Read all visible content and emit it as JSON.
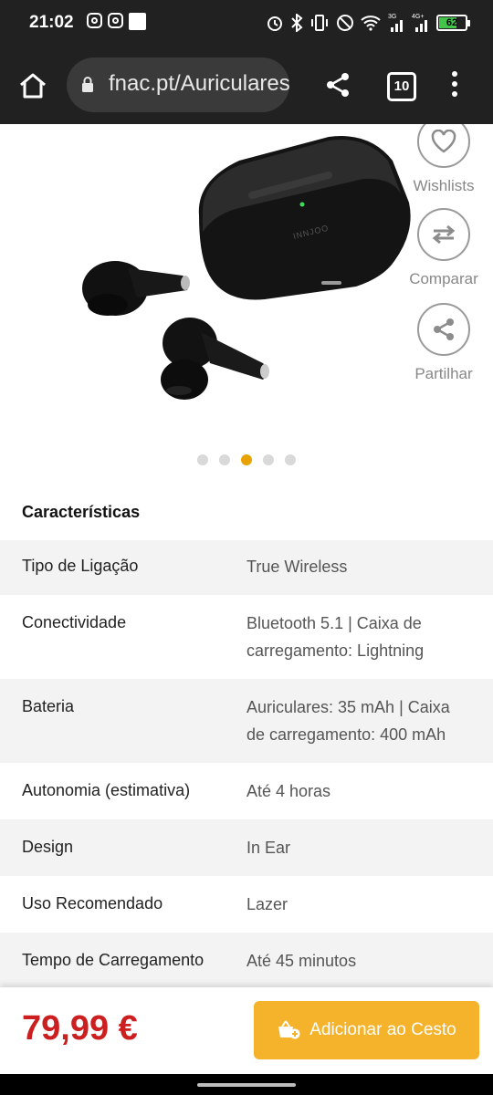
{
  "status_bar": {
    "time": "21:02",
    "notification_icons": [
      "instagram-icon",
      "instagram-icon",
      "app-square-icon"
    ],
    "system_icons": [
      "alarm-icon",
      "bluetooth-icon",
      "vibrate-icon",
      "dnd-icon",
      "wifi-icon",
      "signal-3g-icon",
      "signal-4g-icon",
      "battery-icon"
    ],
    "network_a": "3G",
    "network_b": "4G+",
    "battery_level": "62"
  },
  "browser": {
    "url": "fnac.pt/Auriculares",
    "tab_count": "10",
    "icons": [
      "home-icon",
      "lock-icon",
      "share-icon",
      "tabs-icon",
      "more-vert-icon"
    ]
  },
  "product": {
    "image_alt": "earbuds-with-charging-case",
    "case_brand": "INNJOO",
    "actions": [
      {
        "label": "Wishlists",
        "icon": "heart-icon"
      },
      {
        "label": "Comparar",
        "icon": "swap-icon"
      },
      {
        "label": "Partilhar",
        "icon": "share-icon"
      }
    ],
    "carousel": {
      "total": 5,
      "active_index": 2
    }
  },
  "specs": {
    "title": "Características",
    "rows": [
      {
        "key": "Tipo de Ligação",
        "value": "True Wireless"
      },
      {
        "key": "Conectividade",
        "value": "Bluetooth 5.1 | Caixa de carregamento: Lightning"
      },
      {
        "key": "Bateria",
        "value": "Auriculares: 35 mAh | Caixa de carregamento: 400 mAh"
      },
      {
        "key": "Autonomia (estimativa)",
        "value": "Até 4 horas"
      },
      {
        "key": "Design",
        "value": "In Ear"
      },
      {
        "key": "Uso Recomendado",
        "value": "Lazer"
      },
      {
        "key": "Tempo de Carregamento",
        "value": "Até 45 minutos"
      }
    ]
  },
  "buy_bar": {
    "price": "79,99 €",
    "add_to_cart": "Adicionar ao Cesto",
    "cart_icon": "cart-add-icon"
  },
  "colors": {
    "price": "#cc1f1f",
    "button": "#f4b32b",
    "active_dot": "#e8a300"
  }
}
